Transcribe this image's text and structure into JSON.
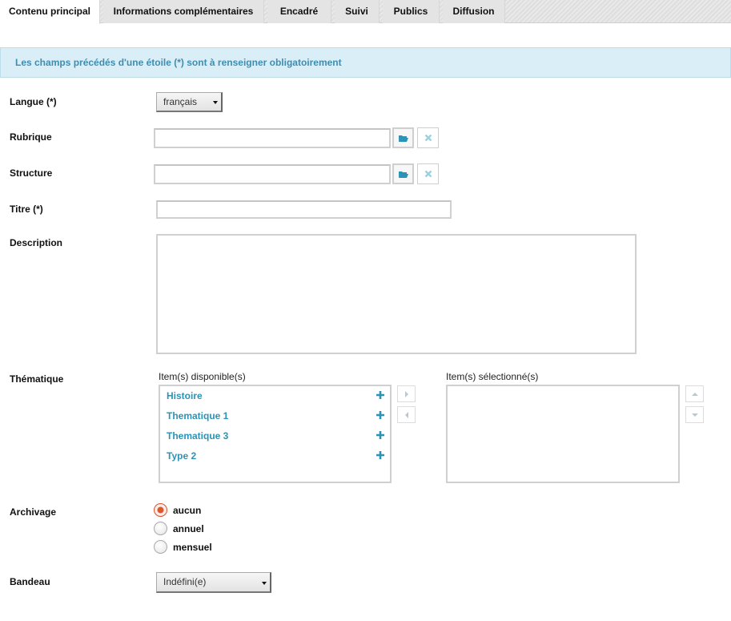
{
  "tabs": [
    {
      "label": "Contenu principal",
      "active": true
    },
    {
      "label": "Informations complémentaires",
      "active": false
    },
    {
      "label": "Encadré",
      "active": false
    },
    {
      "label": "Suivi",
      "active": false
    },
    {
      "label": "Publics",
      "active": false
    },
    {
      "label": "Diffusion",
      "active": false
    }
  ],
  "notice": "Les champs précédés d'une étoile (*) sont à renseigner obligatoirement",
  "fields": {
    "langue": {
      "label": "Langue (*)",
      "value": "français"
    },
    "rubrique": {
      "label": "Rubrique",
      "value": ""
    },
    "structure": {
      "label": "Structure",
      "value": ""
    },
    "titre": {
      "label": "Titre (*)",
      "value": ""
    },
    "description": {
      "label": "Description",
      "value": ""
    },
    "thematique": {
      "label": "Thématique",
      "available_header": "Item(s) disponible(s)",
      "selected_header": "Item(s) sélectionné(s)",
      "available": [
        "Histoire",
        "Thematique 1",
        "Thematique 3",
        "Type 2"
      ],
      "selected": []
    },
    "archivage": {
      "label": "Archivage",
      "options": [
        "aucun",
        "annuel",
        "mensuel"
      ],
      "selected": "aucun"
    },
    "bandeau": {
      "label": "Bandeau",
      "value": "Indéfini(e)"
    }
  },
  "colors": {
    "accent": "#2a93b6",
    "notice_bg": "#d9eef7",
    "radio_checked": "#e0562a"
  }
}
